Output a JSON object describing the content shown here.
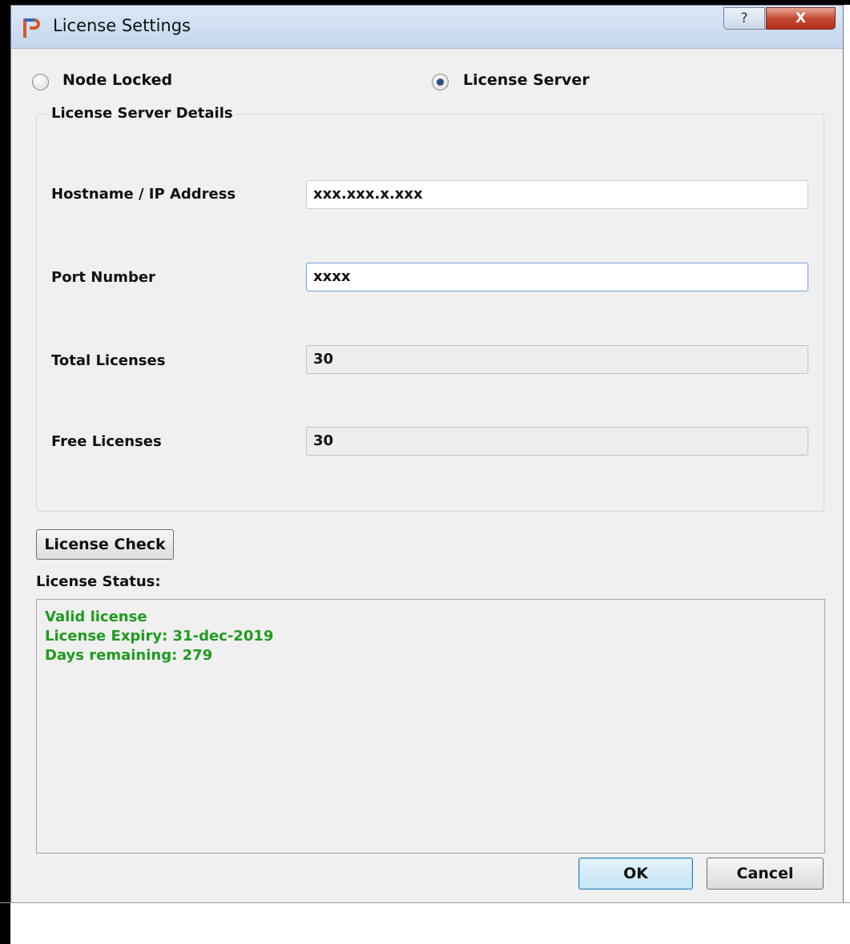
{
  "window": {
    "title": "License Settings",
    "help_label": "?",
    "close_label": "X"
  },
  "mode": {
    "node_locked_label": "Node Locked",
    "license_server_label": "License Server",
    "selected": "License Server"
  },
  "server_details": {
    "group_title": "License Server Details",
    "hostname_label": "Hostname / IP Address",
    "hostname_value": "xxx.xxx.x.xxx",
    "port_label": "Port Number",
    "port_value": "xxxx",
    "total_label": "Total Licenses",
    "total_value": "30",
    "free_label": "Free Licenses",
    "free_value": "30"
  },
  "license_check_label": "License Check",
  "status": {
    "label": "License Status:",
    "lines": [
      "Valid license",
      "License Expiry: 31-dec-2019",
      "Days remaining: 279"
    ],
    "color": "#1f9b1f"
  },
  "buttons": {
    "ok_label": "OK",
    "cancel_label": "Cancel"
  },
  "icons": {
    "app": "app-logo-icon",
    "help": "help-icon",
    "close": "close-icon"
  }
}
